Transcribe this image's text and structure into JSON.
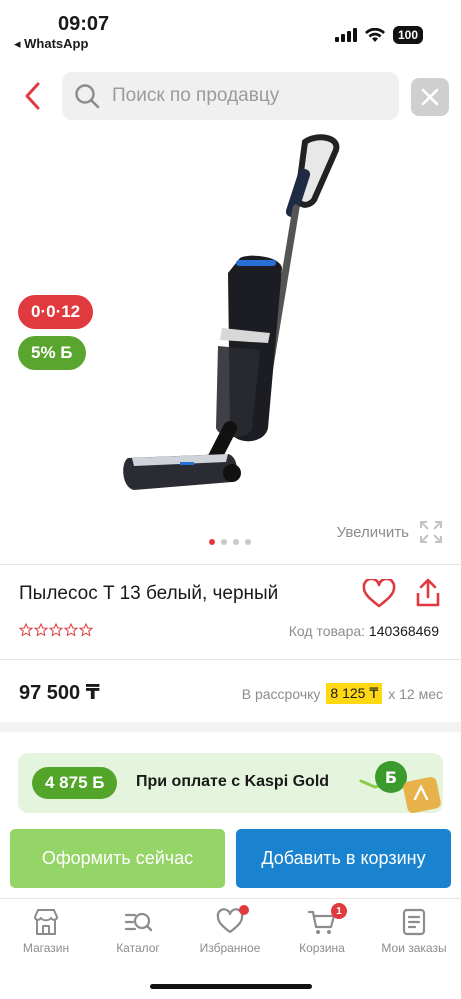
{
  "status_bar": {
    "time": "09:07",
    "back_app": "◂ WhatsApp",
    "battery": "100",
    "icons": [
      "signal-icon",
      "wifi-icon",
      "battery-icon"
    ]
  },
  "search": {
    "placeholder": "Поиск по продавцу",
    "icons": [
      "back-chevron-icon",
      "search-icon",
      "close-icon"
    ]
  },
  "gallery": {
    "badge_installment": "0·0·12",
    "badge_bonus": "5% Б",
    "zoom_label": "Увеличить",
    "dots": 4,
    "active_dot": 0
  },
  "product": {
    "title": "Пылесос T 13 белый, черный",
    "code_label": "Код товара:",
    "code_value": "140368469",
    "rating_stars": 0,
    "rating_max": 5,
    "price": "97 500 ₸",
    "installment_prefix": "В рассрочку",
    "installment_amount": "8 125 ₸",
    "installment_suffix": "х 12 мес"
  },
  "kaspi_gold": {
    "bonus": "4 875 Б",
    "text": "При оплате с Kaspi Gold"
  },
  "actions": {
    "checkout": "Оформить сейчас",
    "add_to_cart": "Добавить в корзину"
  },
  "tabbar": {
    "items": [
      {
        "label": "Магазин",
        "icon": "shop-icon"
      },
      {
        "label": "Каталог",
        "icon": "catalog-icon"
      },
      {
        "label": "Избранное",
        "icon": "heart-icon",
        "dot": true
      },
      {
        "label": "Корзина",
        "icon": "cart-icon",
        "count": "1"
      },
      {
        "label": "Мои заказы",
        "icon": "orders-icon"
      }
    ]
  },
  "colors": {
    "accent_red": "#e0393e",
    "kaspi_green": "#53a52a",
    "checkout_green": "#95d466",
    "cart_blue": "#1a83d0",
    "installment_highlight": "#ffd814"
  }
}
